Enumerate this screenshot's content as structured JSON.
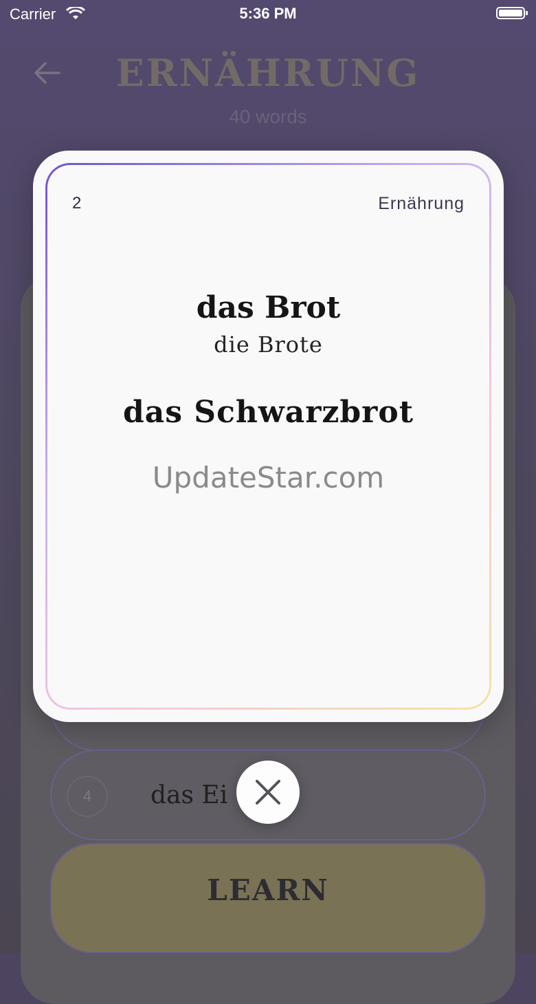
{
  "status_bar": {
    "carrier": "Carrier",
    "time": "5:36 PM"
  },
  "header": {
    "title": "ERNÄHRUNG",
    "subtitle": "40 words"
  },
  "word_list": [
    {
      "number": "4",
      "word": "das Ei"
    }
  ],
  "learn_button": {
    "label": "LEARN"
  },
  "card": {
    "number": "2",
    "category": "Ernährung",
    "word": "das Brot",
    "plural": "die Brote",
    "compound": "das Schwarzbrot",
    "watermark": "UpdateStar.com"
  },
  "icons": {
    "back": "arrow-left-icon",
    "close": "close-icon",
    "wifi": "wifi-icon",
    "battery": "battery-icon"
  },
  "colors": {
    "card_border_start": "#6e52cf",
    "card_border_end": "#f4e2a4"
  }
}
